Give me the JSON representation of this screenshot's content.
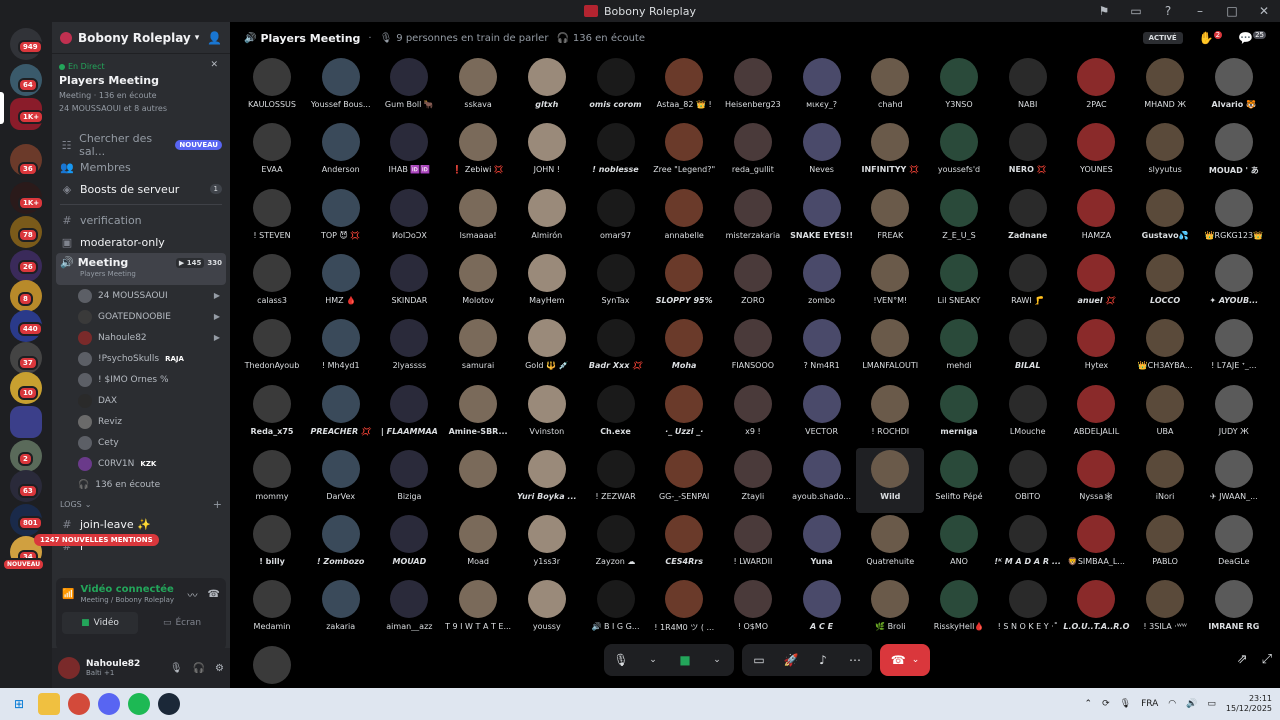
{
  "window": {
    "title": "Bobony Roleplay",
    "controls": [
      "minimize",
      "maximize",
      "close"
    ]
  },
  "rail": {
    "badges": [
      "949",
      "64",
      "1K+",
      "36",
      "1K+",
      "78",
      "26",
      "8",
      "440",
      "37",
      "10",
      "2",
      "63",
      "801",
      "34"
    ],
    "nouveau_label": "NOUVEAU"
  },
  "sidebar": {
    "server_name": "Bobony Roleplay",
    "live": {
      "tag": "En Direct",
      "title": "Players Meeting",
      "meta": "Meeting",
      "listening": "136 en écoute",
      "members": "24 MOUSSAOUI et 8 autres"
    },
    "rows": [
      {
        "label": "Chercher des sal...",
        "badge": "NOUVEAU",
        "icon": "☷"
      },
      {
        "label": "Membres",
        "icon": "👥"
      },
      {
        "label": "Boosts de serveur",
        "count": "1",
        "icon": "◈"
      }
    ],
    "channels": [
      {
        "label": "verification",
        "icon": "#"
      },
      {
        "label": "moderator-only",
        "icon": "▣"
      }
    ],
    "meeting": {
      "name": "Meeting",
      "cams": "145",
      "count": "330",
      "sub": "Players Meeting"
    },
    "voice_members": [
      "24 MOUSSAOUI",
      "GOATEDNOOBIE",
      "Nahoule82",
      "!PsychoSkulls",
      "! $IMO Ornes %",
      "DAX",
      "Reviz",
      "Cety",
      "C0RV1N"
    ],
    "voice_tags": {
      "raja": "RAJA",
      "kzk": "KZK"
    },
    "listening_count": "136 en écoute",
    "logs_label": "LOGS",
    "log_channels": [
      "join-leave ✨",
      "r"
    ],
    "mentions": "1247 NOUVELLES MENTIONS",
    "voice_connected": {
      "title": "Vidéo connectée",
      "sub": "Meeting",
      "server": "/ Bobony Roleplay",
      "video_label": "Vidéo",
      "screen_label": "Écran"
    },
    "user": {
      "name": "Nahoule82",
      "status": "Balti +1"
    }
  },
  "main": {
    "title": "Players Meeting",
    "speaking": "9 personnes en train de parler",
    "listening": "136 en écoute",
    "active_label": "ACTIVÉ",
    "notif_count": "2",
    "activity_count": "25",
    "participants": [
      "KAULOSSUS",
      "Youssef Bous...",
      "Gum Boll 🐂",
      "sskava",
      "gltxh",
      "omis corom",
      "Astaa_82 👑 !",
      "Heisenberg23",
      "мιкєу_?",
      "chahd",
      "Y3NSO",
      "NABI",
      "2PAC",
      "MHAND Ж",
      "Alvario 🐯",
      "EVAA",
      "Anderson",
      "IHAB 🆔🆔",
      "❗ Zebiwi 💢",
      "JOHN !",
      "! noblesse",
      "Zree \"Legend?\"",
      "reda_gullit",
      "Neves",
      "INFINITYY 💢",
      "youssefs'd",
      "NERO 💢",
      "YOUNES",
      "slyyutus",
      "MOUAD ' あ",
      "! STEVEN",
      "TOP 😈 💢",
      "ИoIƆoƆX",
      "lsmaaaa!",
      "Almirón",
      "omar97",
      "annabelle",
      "misterzakaria",
      "SNAKE EYES!!",
      "FREAK",
      "Z_E_U_S",
      "Zadnane",
      "HAMZA",
      "Gustavo💦",
      "👑RGKG123👑",
      "calass3",
      "HMZ 🩸",
      "SKINDAR",
      "Molotov",
      "MayHem",
      "SynTax",
      "SLOPPY 95%",
      "ZORO",
      "zombo",
      "!VEN°M!",
      "Lil SNEAKY",
      "RAWI 🦵",
      "anuel 💢",
      "LOCCO",
      "✦ AYOUB...",
      "ThedonAyoub",
      "! Mh4yd1",
      "2lyassss",
      "samurai",
      "Gold 🔱 💉",
      "Badr Xxx 💢",
      "Moha",
      "FIANSOOO",
      "? Nm4R1",
      "LMANFALOUTI",
      "mehdi",
      "BILAL",
      "Hytex",
      "👑CH3AYBA...",
      "! L7AJE ᐩ_...",
      "Reda_x75",
      "PREACHER 💢",
      "| FLAAMMAA",
      "Amine-SBR...",
      "Vvinston",
      "Ch.exe",
      "·_ Uzzi _·",
      "x9 !",
      "VECTOR",
      "! ROCHDI",
      "merniga",
      "LMouche",
      "ABDELJALIL",
      "UBA",
      "JUDY Ж",
      "mommy",
      "DarVex",
      "Biziga",
      "",
      "Yuri Boyka ...",
      "! ZEZWAR",
      "GG-_-SENPAI",
      "Ztayli",
      "ayoub.shado...",
      "Wild",
      "Selifto Pépé",
      "OBITO",
      "Nyssa🕸",
      "iNori",
      "✈ JWAAN_...",
      "! billy",
      "! Zombozo",
      "MOUAD",
      "Moad",
      "y1ss3r",
      "Zayzon ☁",
      "CES4Rrs",
      "! LWARDII",
      "Yuna",
      "Quatrehuite",
      "ANO",
      "!ᴷ M A D A R ...",
      "🦁SIMBAA_L...",
      "PABLO",
      "DeaGLe",
      "Medamin",
      "zakaria",
      "aiman__azz",
      "T 9 I W T A T E...",
      "youssy",
      "🔊 B I G G...",
      "! 1R4M0 ツ ( ...",
      "! O$MO",
      "A C E",
      "🌿 Broli",
      "RisskyHell🩸",
      "! S N O K E Y ·˚",
      "L.O.U..T.A..R.O",
      "! 3SILA ·ᵂᵂ",
      "IMRANE RG",
      ""
    ]
  },
  "taskbar": {
    "lang": "FRA",
    "time": "23:11",
    "date": "15/12/2025"
  },
  "colors": {
    "accent": "#5865f2",
    "green": "#23a55a",
    "red": "#da373c",
    "bg": "#000000"
  }
}
